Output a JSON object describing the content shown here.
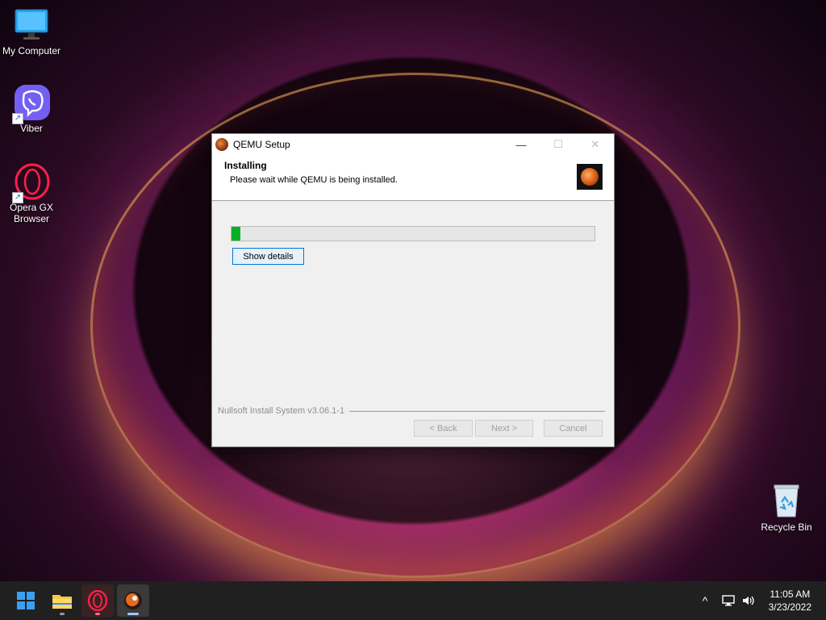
{
  "desktop": {
    "icons": [
      {
        "label": "My Computer"
      },
      {
        "label": "Viber"
      },
      {
        "label": "Opera GX\nBrowser"
      },
      {
        "label": "Recycle Bin"
      }
    ]
  },
  "window": {
    "title": "QEMU Setup",
    "header_title": "Installing",
    "header_subtitle": "Please wait while QEMU is being installed.",
    "progress_percent": 2.5,
    "show_details_label": "Show details",
    "branding": "Nullsoft Install System v3.06.1-1",
    "back_label": "< Back",
    "next_label": "Next >",
    "cancel_label": "Cancel",
    "minimize_glyph": "—",
    "maximize_glyph": "☐",
    "close_glyph": "✕"
  },
  "taskbar": {
    "time": "11:05 AM",
    "date": "3/23/2022",
    "chevron_glyph": "^"
  },
  "colors": {
    "progress_fill": "#06b025",
    "focus_accent": "#0078d7",
    "taskbar_bg": "#202020"
  }
}
